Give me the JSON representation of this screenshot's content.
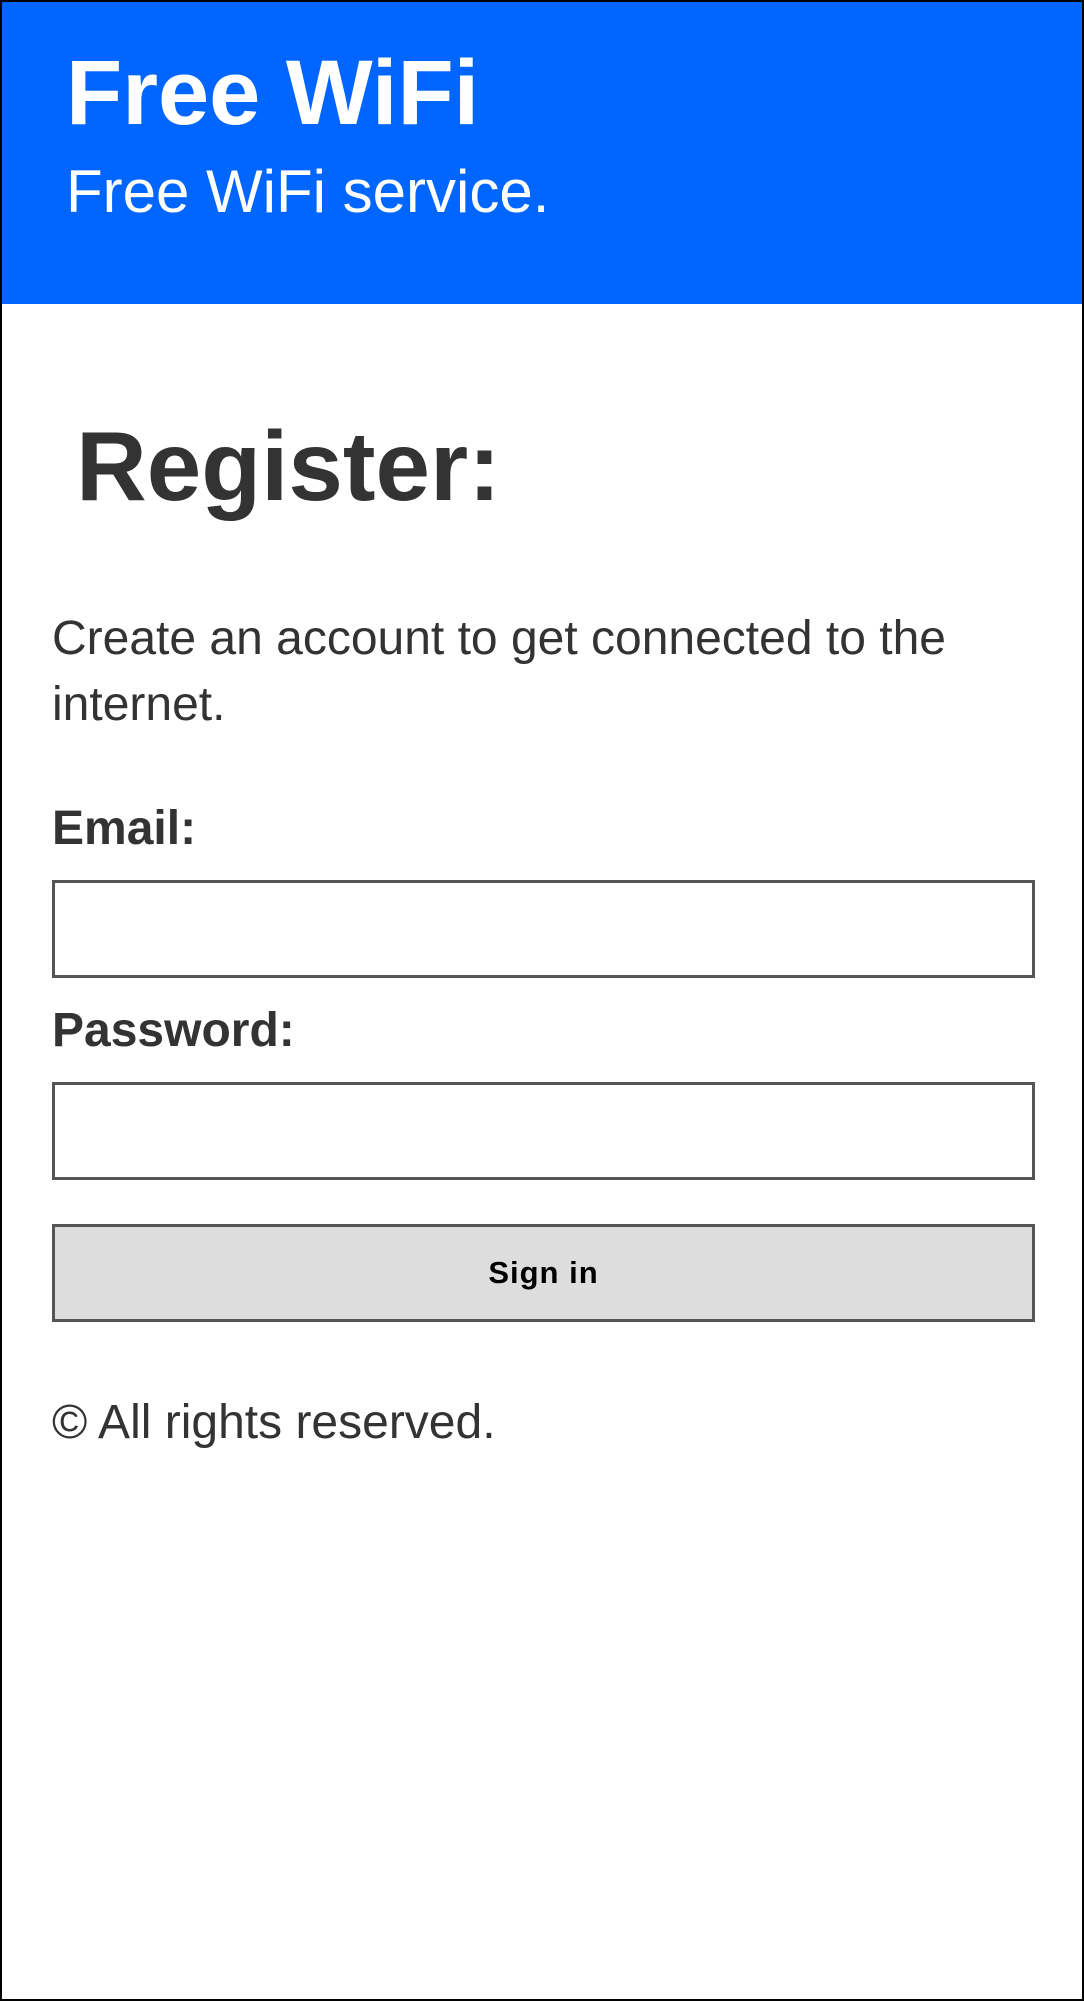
{
  "header": {
    "title": "Free WiFi",
    "tagline": "Free WiFi service."
  },
  "main": {
    "heading": "Register:",
    "intro": "Create an account to get connected to the internet.",
    "email_label": "Email:",
    "email_value": "",
    "password_label": "Password:",
    "password_value": "",
    "signin_label": "Sign in"
  },
  "footer": {
    "text": "© All rights reserved."
  },
  "colors": {
    "header_background": "#0066ff",
    "header_text": "#ffffff",
    "body_text": "#333333",
    "button_background": "#dddddd"
  }
}
